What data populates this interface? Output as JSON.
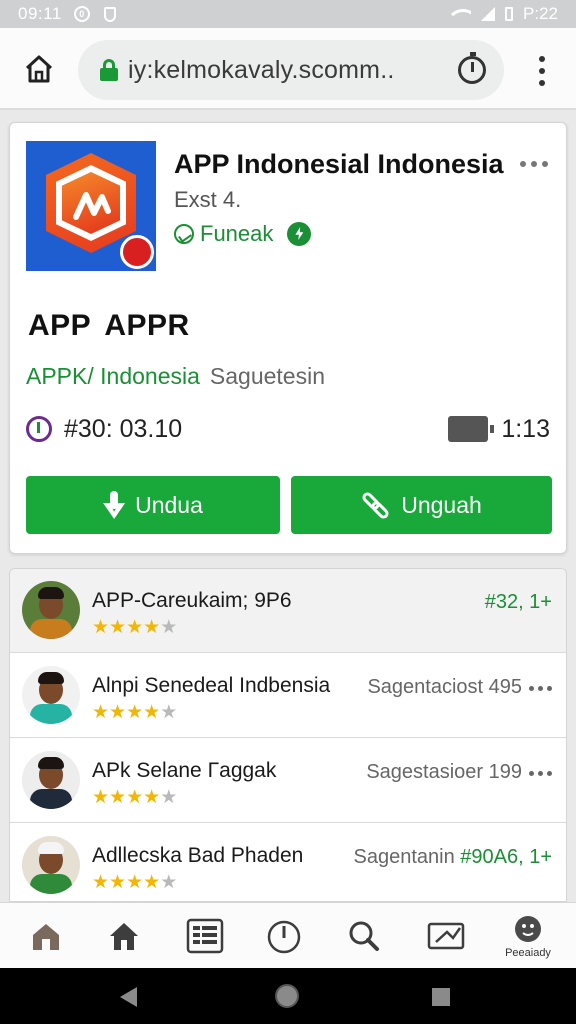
{
  "status_bar": {
    "time": "09:11",
    "notif_badge": "0",
    "right_text": "P:22"
  },
  "browser": {
    "url": "iy:kelmokavaly.scomm.."
  },
  "app": {
    "title": "APP Indonesial Indonesia",
    "subtitle": "Exst 4.",
    "tag": "Funeak",
    "big_title": "APP  APPR",
    "developer": "APPK/ Indonesia",
    "category": "Saguetesin",
    "meta_left": "#30: 03.10",
    "meta_right": "1:13",
    "download_label": "Undua",
    "share_label": "Unguah"
  },
  "reviews": [
    {
      "name": "APP-Careukaim; 9P6",
      "stars": 4,
      "meta": "#32, 1+",
      "meta_color": "green",
      "more": false
    },
    {
      "name": "Alnpi Senedeal Indbensia",
      "stars": 4,
      "meta": "Sagentaciost 495",
      "meta_color": "gray",
      "more": true
    },
    {
      "name": "APk Selane Γaggak",
      "stars": 4,
      "meta": "Sagestasioer 199",
      "meta_color": "gray",
      "more": true
    },
    {
      "name": "Adllecska Bad Phaden",
      "stars": 4,
      "meta": "Sagentanin #90A6, 1+",
      "meta_color": "mixed",
      "more": false
    }
  ],
  "reviews_meta_split": {
    "gray_part": "Sagentanin ",
    "green_part": "#90A6, 1+"
  },
  "bottom_nav": {
    "items": [
      "home-outline-icon",
      "home-filled-icon",
      "list-grid-icon",
      "timer-icon",
      "search-icon",
      "mail-check-icon",
      "profile-icon"
    ],
    "profile_label": "Peeaiady"
  },
  "colors": {
    "green": "#19a83a",
    "star": "#f2b705",
    "app_icon_bg": "#1e5ed0"
  }
}
